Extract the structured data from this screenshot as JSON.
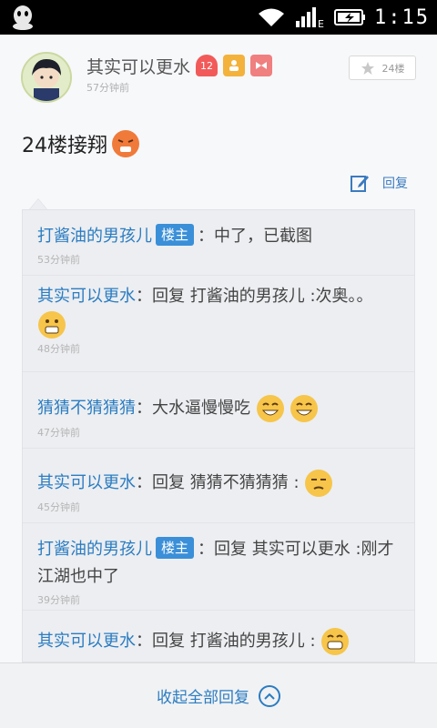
{
  "status_bar": {
    "time": "1:15",
    "network": "E"
  },
  "post": {
    "author": "其实可以更水",
    "level": "12",
    "time": "57分钟前",
    "floor": "24楼",
    "content": "24楼接翔",
    "reply_label": "回复"
  },
  "comments": [
    {
      "user": "打酱油的男孩儿",
      "is_op": true,
      "op_label": "楼主",
      "text": "：中了，已截图",
      "time": "53分钟前"
    },
    {
      "user": "其实可以更水",
      "is_op": false,
      "text": "：回复 打酱油的男孩儿 :次奥。。",
      "time": "48分钟前"
    },
    {
      "user": "猜猜不猜猜猜",
      "is_op": false,
      "text": "：大水逼慢慢吃",
      "time": "47分钟前"
    },
    {
      "user": "其实可以更水",
      "is_op": false,
      "text": "：回复 猜猜不猜猜猜 :",
      "time": "45分钟前"
    },
    {
      "user": "打酱油的男孩儿",
      "is_op": true,
      "op_label": "楼主",
      "text": "：回复 其实可以更水 :刚才江湖也中了",
      "time": "39分钟前"
    },
    {
      "user": "其实可以更水",
      "is_op": false,
      "text": "：回复 打酱油的男孩儿 :",
      "time": ""
    }
  ],
  "footer": {
    "collapse_label": "收起全部回复"
  },
  "colors": {
    "link_blue": "#2b7cc1",
    "op_badge": "#3a8fd8"
  },
  "icons": [
    "qq-icon",
    "wifi-icon",
    "signal-icon",
    "battery-icon",
    "star-icon",
    "edit-icon",
    "chevron-up-icon"
  ]
}
